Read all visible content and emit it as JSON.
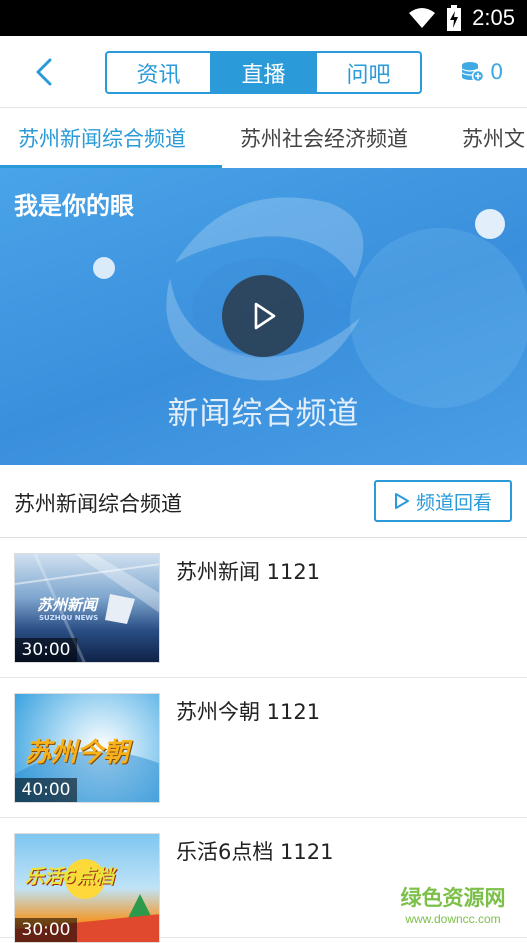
{
  "status": {
    "time": "2:05"
  },
  "header": {
    "segments": [
      "资讯",
      "直播",
      "问吧"
    ],
    "active_segment": 1,
    "coin_count": "0"
  },
  "channel_tabs": [
    "苏州新闻综合频道",
    "苏州社会经济频道",
    "苏州文"
  ],
  "video": {
    "title": "我是你的眼",
    "logo_text": "新闻综合频道"
  },
  "channel_header": {
    "title": "苏州新闻综合频道",
    "replay_label": "频道回看"
  },
  "programs": [
    {
      "title": "苏州新闻 1121",
      "duration": "30:00",
      "thumb_text": "苏州新闻",
      "thumb_sub": "SUZHOU NEWS"
    },
    {
      "title": "苏州今朝 1121",
      "duration": "40:00",
      "thumb_text": "苏州今朝"
    },
    {
      "title": "乐活6点档 1121",
      "duration": "30:00",
      "thumb_text": "乐活6点档"
    }
  ],
  "watermark": {
    "name": "绿色资源网",
    "url": "www.downcc.com"
  },
  "colors": {
    "accent": "#2a9ad9",
    "status_bar": "#000000",
    "watermark": "#7cc04a"
  }
}
